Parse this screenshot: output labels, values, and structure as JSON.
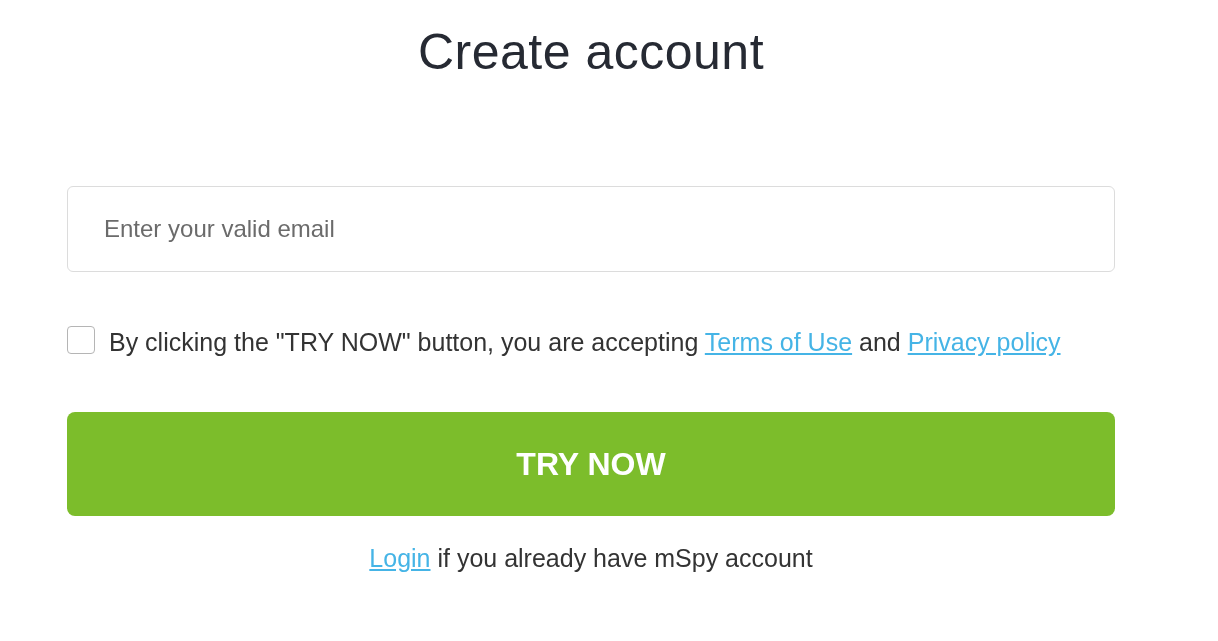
{
  "title": "Create account",
  "email_field": {
    "placeholder": "Enter your valid email"
  },
  "consent": {
    "checked": false,
    "text_before": "By clicking the \"TRY NOW\" button, you are accepting",
    "terms_link": "Terms of Use",
    "joiner": "and",
    "privacy_link": "Privacy policy"
  },
  "submit_button": {
    "label": "TRY NOW"
  },
  "login": {
    "link": "Login",
    "text": "if you already have mSpy account"
  }
}
